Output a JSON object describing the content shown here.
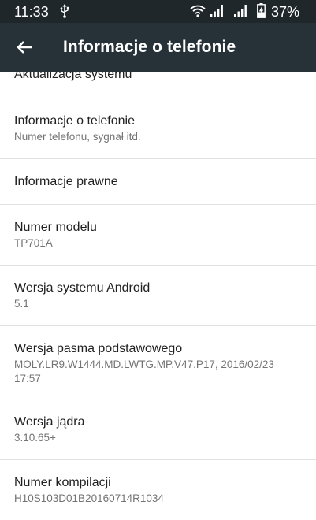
{
  "status_bar": {
    "time": "11:33",
    "battery_percent": "37%",
    "icons": [
      "usb-icon",
      "wifi-icon",
      "signal-icon",
      "signal-icon",
      "battery-charging-icon"
    ]
  },
  "app_bar": {
    "title": "Informacje o telefonie",
    "back_icon": "arrow-back-icon"
  },
  "items": [
    {
      "title": "Aktualizacja systemu",
      "subtitle": ""
    },
    {
      "title": "Informacje o telefonie",
      "subtitle": "Numer telefonu, sygnał itd."
    },
    {
      "title": "Informacje prawne",
      "subtitle": ""
    },
    {
      "title": "Numer modelu",
      "subtitle": "TP701A"
    },
    {
      "title": "Wersja systemu Android",
      "subtitle": "5.1"
    },
    {
      "title": "Wersja pasma podstawowego",
      "subtitle": "MOLY.LR9.W1444.MD.LWTG.MP.V47.P17, 2016/02/23 17:57"
    },
    {
      "title": "Wersja jądra",
      "subtitle": "3.10.65+"
    },
    {
      "title": "Numer kompilacji",
      "subtitle": "H10S103D01B20160714R1034"
    }
  ],
  "colors": {
    "status_bar_bg": "#1f272b",
    "app_bar_bg": "#263238",
    "divider": "#e2e2e2"
  }
}
